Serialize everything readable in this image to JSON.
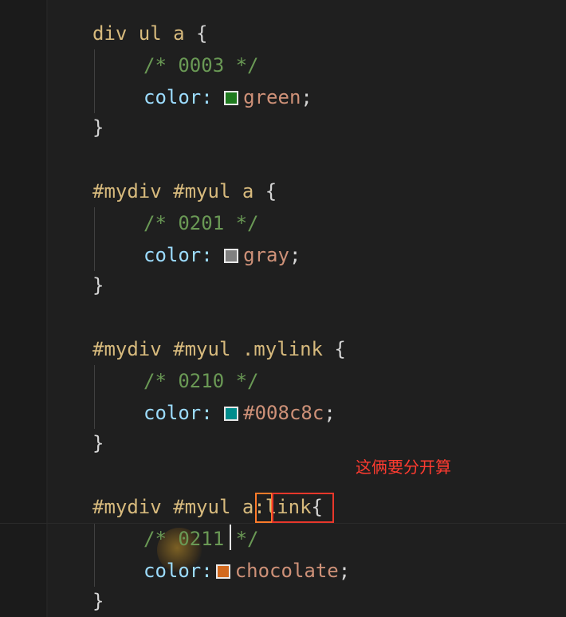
{
  "code": {
    "block1": {
      "selector": "div ul a",
      "open": " {",
      "comment": "/* 0003 */",
      "prop": "color:",
      "swatch_color": "#1f7a1f",
      "value": "green",
      "semi": ";",
      "close": "}"
    },
    "block2": {
      "selector": "#mydiv #myul a",
      "open": " {",
      "comment": "/* 0201 */",
      "prop": "color:",
      "swatch_color": "#808080",
      "value": "gray",
      "semi": ";",
      "close": "}"
    },
    "block3": {
      "selector": "#mydiv #myul .mylink",
      "open": " {",
      "comment": "/* 0210 */",
      "prop": "color:",
      "swatch_color": "#008c8c",
      "value": "#008c8c",
      "semi": ";",
      "close": "}"
    },
    "block4": {
      "selector_prefix": "#mydiv #myul ",
      "selector_a": "a",
      "selector_pseudo": ":link",
      "open": "{",
      "comment_open": "/* ",
      "comment_num": "0211",
      "comment_close": " */",
      "prop": "color:",
      "swatch_color": "#d2691e",
      "value": "chocolate",
      "semi": ";",
      "close": "}"
    }
  },
  "annotation": {
    "note_text": "这俩要分开算",
    "box_orange_color": "#ff7b2a",
    "box_red_color": "#e8372b",
    "note_color": "#ff3b30"
  }
}
